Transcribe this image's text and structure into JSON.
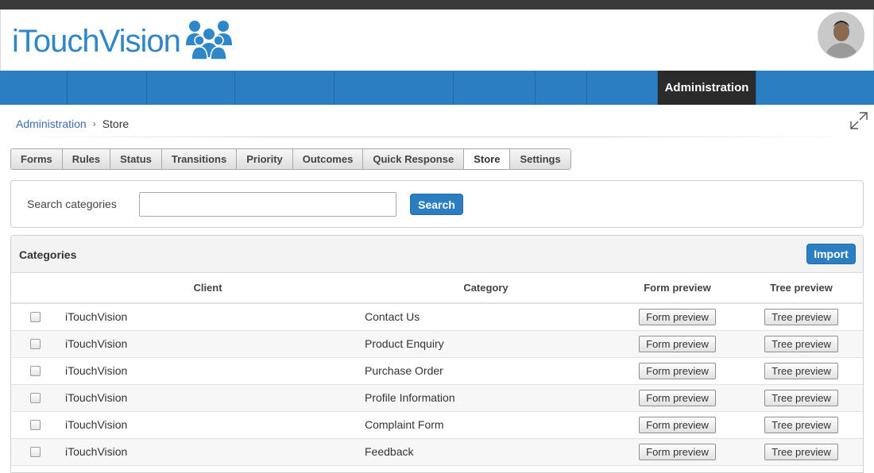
{
  "brand": {
    "name": "iTouchVision",
    "accent": "#2b7ec1",
    "dark": "#2b2b2b"
  },
  "nav": {
    "active_label": "Administration"
  },
  "breadcrumb": {
    "root": "Administration",
    "current": "Store"
  },
  "tabs": [
    {
      "label": "Forms"
    },
    {
      "label": "Rules"
    },
    {
      "label": "Status"
    },
    {
      "label": "Transitions"
    },
    {
      "label": "Priority"
    },
    {
      "label": "Outcomes"
    },
    {
      "label": "Quick Response"
    },
    {
      "label": "Store",
      "active": true
    },
    {
      "label": "Settings"
    }
  ],
  "search": {
    "label": "Search categories",
    "value": "",
    "button": "Search"
  },
  "categories": {
    "title": "Categories",
    "import_label": "Import",
    "columns": {
      "client": "Client",
      "category": "Category",
      "form_preview": "Form preview",
      "tree_preview": "Tree preview"
    },
    "rows": [
      {
        "client": "iTouchVision",
        "category": "Contact Us",
        "form_btn": "Form preview",
        "tree_btn": "Tree preview"
      },
      {
        "client": "iTouchVision",
        "category": "Product Enquiry",
        "form_btn": "Form preview",
        "tree_btn": "Tree preview"
      },
      {
        "client": "iTouchVision",
        "category": "Purchase Order",
        "form_btn": "Form preview",
        "tree_btn": "Tree preview"
      },
      {
        "client": "iTouchVision",
        "category": "Profile Information",
        "form_btn": "Form preview",
        "tree_btn": "Tree preview"
      },
      {
        "client": "iTouchVision",
        "category": "Complaint Form",
        "form_btn": "Form preview",
        "tree_btn": "Tree preview"
      },
      {
        "client": "iTouchVision",
        "category": "Feedback",
        "form_btn": "Form preview",
        "tree_btn": "Tree preview"
      }
    ]
  },
  "icons": {
    "logo": "people-group-icon",
    "expand": "expand-arrows-icon",
    "avatar": "user-avatar"
  }
}
